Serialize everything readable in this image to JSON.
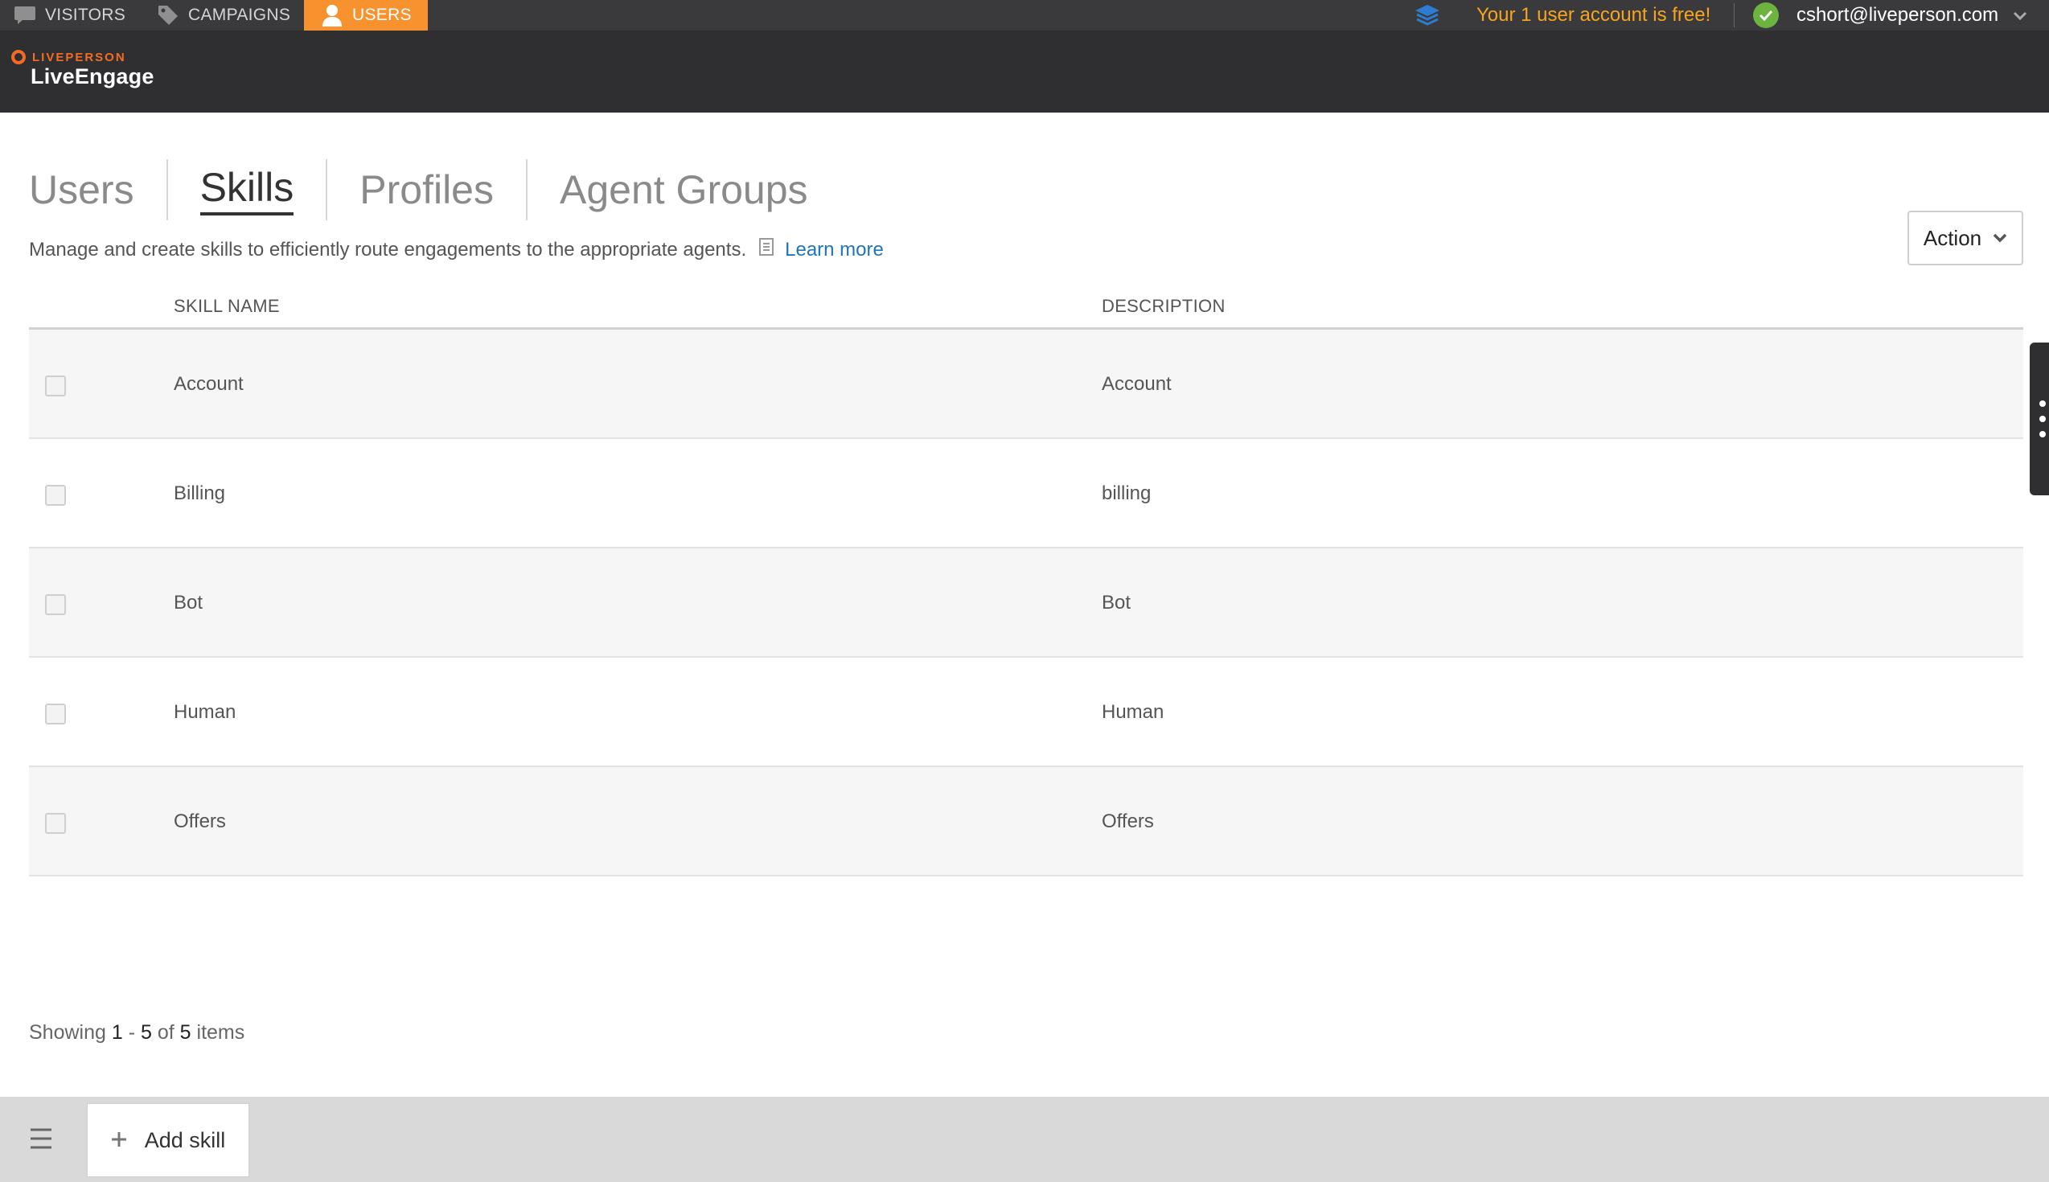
{
  "topnav": {
    "tabs": [
      {
        "label": "VISITORS",
        "icon": "chat-bubble-icon"
      },
      {
        "label": "CAMPAIGNS",
        "icon": "tag-icon"
      },
      {
        "label": "USERS",
        "icon": "user-icon",
        "active": true
      }
    ],
    "promo": "Your 1 user account is free!",
    "user_email": "cshort@liveperson.com",
    "accent_color": "#f7922e"
  },
  "header": {
    "brand_top": "LIVEPERSON",
    "brand_main": "LiveEngage"
  },
  "subtabs": {
    "items": [
      {
        "label": "Users"
      },
      {
        "label": "Skills",
        "active": true
      },
      {
        "label": "Profiles"
      },
      {
        "label": "Agent Groups"
      }
    ]
  },
  "page": {
    "description": "Manage and create skills to efficiently route engagements to the appropriate agents.",
    "learn_more": "Learn more",
    "action_label": "Action"
  },
  "table": {
    "columns": [
      "SKILL NAME",
      "DESCRIPTION"
    ],
    "rows": [
      {
        "name": "Account",
        "description": "Account"
      },
      {
        "name": "Billing",
        "description": "billing"
      },
      {
        "name": "Bot",
        "description": "Bot"
      },
      {
        "name": "Human",
        "description": "Human"
      },
      {
        "name": "Offers",
        "description": "Offers"
      }
    ]
  },
  "pagination": {
    "prefix": "Showing",
    "from": "1",
    "dash": "-",
    "to": "5",
    "of": "of",
    "total": "5",
    "suffix": "items"
  },
  "footer": {
    "add_label": "Add skill"
  }
}
